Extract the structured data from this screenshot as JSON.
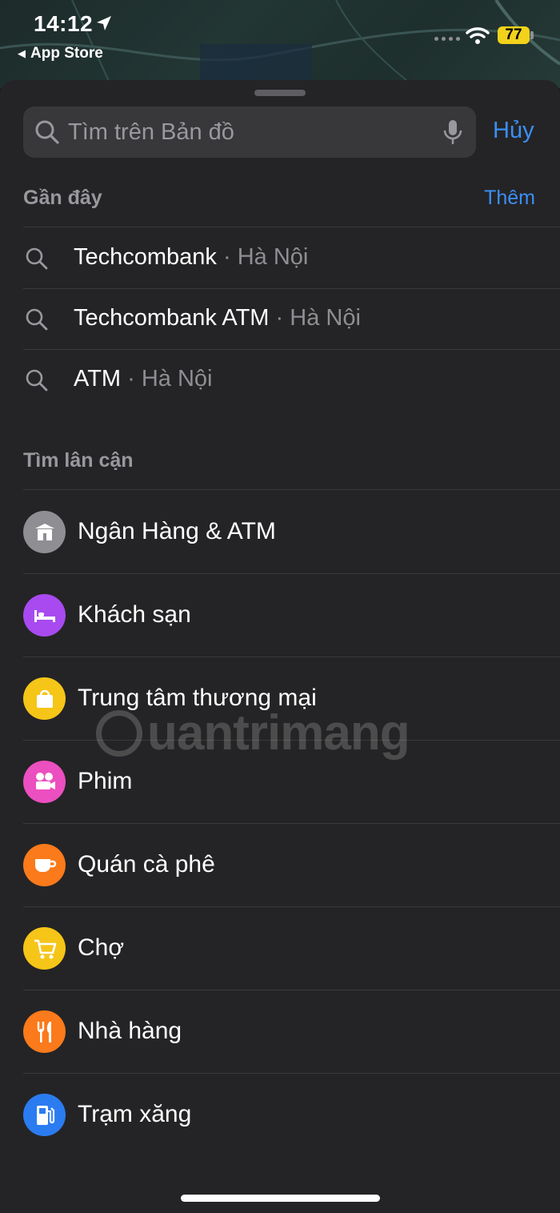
{
  "status_bar": {
    "time": "14:12",
    "back_label": "App Store",
    "battery": "77"
  },
  "search": {
    "placeholder": "Tìm trên Bản đồ",
    "cancel_label": "Hủy"
  },
  "recents": {
    "title": "Gần đây",
    "more_label": "Thêm",
    "separator": "·",
    "items": [
      {
        "name": "Techcombank",
        "location": "Hà Nội"
      },
      {
        "name": "Techcombank ATM",
        "location": "Hà Nội"
      },
      {
        "name": "ATM",
        "location": "Hà Nội"
      }
    ]
  },
  "nearby": {
    "title": "Tìm lân cận",
    "items": [
      {
        "label": "Ngân Hàng & ATM",
        "icon": "bank-icon",
        "color": "#8e8e93"
      },
      {
        "label": "Khách sạn",
        "icon": "bed-icon",
        "color": "#a84af0"
      },
      {
        "label": "Trung tâm thương mại",
        "icon": "shopping-bag-icon",
        "color": "#f5c518"
      },
      {
        "label": "Phim",
        "icon": "movie-camera-icon",
        "color": "#ec4fbf"
      },
      {
        "label": "Quán cà phê",
        "icon": "coffee-cup-icon",
        "color": "#fb7a1b"
      },
      {
        "label": "Chợ",
        "icon": "shopping-cart-icon",
        "color": "#f5c518"
      },
      {
        "label": "Nhà hàng",
        "icon": "fork-knife-icon",
        "color": "#fb7a1b"
      },
      {
        "label": "Trạm xăng",
        "icon": "fuel-pump-icon",
        "color": "#2b7cf0"
      }
    ]
  },
  "watermark": "uantrimang",
  "colors": {
    "accent": "#3b8ff5",
    "sheet": "#242426",
    "secondary_text": "#98989e"
  }
}
